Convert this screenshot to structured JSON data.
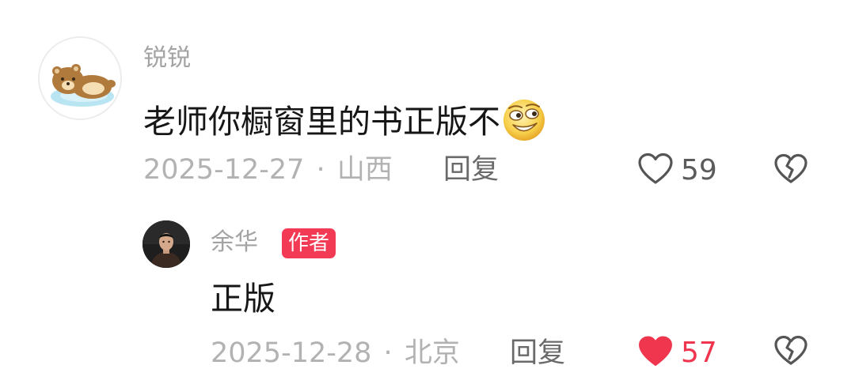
{
  "comment": {
    "username": "锐锐",
    "text": "老师你橱窗里的书正版不",
    "emoji": "grinning-emoji",
    "date": "2025-12-27",
    "separator": "·",
    "location": "山西",
    "reply_label": "回复",
    "like_count": "59",
    "liked": false,
    "avatar": "bear-avatar"
  },
  "reply": {
    "username": "余华",
    "badge": "作者",
    "text": "正版",
    "date": "2025-12-28",
    "separator": "·",
    "location": "北京",
    "reply_label": "回复",
    "like_count": "57",
    "liked": true,
    "avatar": "person-avatar"
  },
  "colors": {
    "like_active": "#f0364f",
    "badge": "#f23a55",
    "meta_text": "#b2b2b2"
  }
}
